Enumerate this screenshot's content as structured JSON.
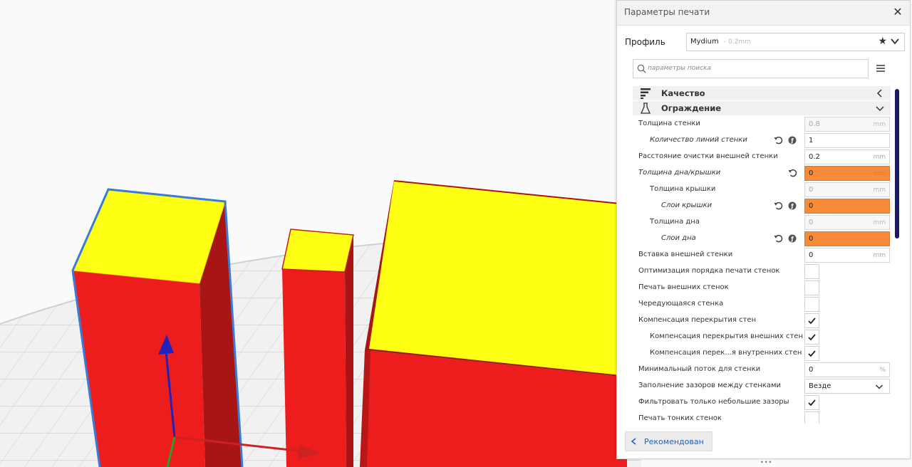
{
  "panel": {
    "title": "Параметры печати",
    "profile_label": "Профиль",
    "profile_name": "Mydium",
    "profile_layer": "- 0.2mm",
    "search_placeholder": "параметры поиска",
    "recommended_label": "Рекомендован"
  },
  "categories": [
    {
      "label": "Качество",
      "icon": "quality-icon",
      "state": "collapsed"
    },
    {
      "label": "Ограждение",
      "icon": "shell-icon",
      "state": "expanded"
    }
  ],
  "settings": [
    {
      "label": "Толщина стенки",
      "value": "0.8",
      "unit": "mm",
      "control": "field",
      "state": "disabled"
    },
    {
      "label": "Количество линий стенки",
      "value": "1",
      "unit": "",
      "control": "field",
      "state": "normal",
      "italic": true,
      "reset": true,
      "info": true
    },
    {
      "label": "Расстояние очистки внешней стенки",
      "value": "0.2",
      "unit": "mm",
      "control": "field",
      "state": "normal"
    },
    {
      "label": "Толщина дна/крышки",
      "value": "0",
      "unit": "mm",
      "control": "field",
      "state": "warning",
      "italic": true,
      "reset": true
    },
    {
      "label": "Толщина крышки",
      "value": "0",
      "unit": "mm",
      "control": "field",
      "state": "disabled"
    },
    {
      "label": "Слои крышки",
      "value": "0",
      "unit": "",
      "control": "field",
      "state": "warning",
      "italic": true,
      "reset": true,
      "info": true
    },
    {
      "label": "Толщина дна",
      "value": "0",
      "unit": "mm",
      "control": "field",
      "state": "disabled"
    },
    {
      "label": "Слои дна",
      "value": "0",
      "unit": "",
      "control": "field",
      "state": "warning",
      "italic": true,
      "reset": true,
      "info": true
    },
    {
      "label": "Вставка внешней стенки",
      "value": "0",
      "unit": "mm",
      "control": "field",
      "state": "normal"
    },
    {
      "label": "Оптимизация порядка печати стенок",
      "control": "checkbox",
      "checked": false
    },
    {
      "label": "Печать внешних стенок",
      "control": "checkbox",
      "checked": false
    },
    {
      "label": "Чередующаяся стенка",
      "control": "checkbox",
      "checked": false
    },
    {
      "label": "Компенсация перекрытия стен",
      "control": "checkbox",
      "checked": true
    },
    {
      "label": "Компенсация перекрытия внешних стен",
      "control": "checkbox",
      "checked": true
    },
    {
      "label": "Компенсация перек...я внутренних стен",
      "control": "checkbox",
      "checked": true
    },
    {
      "label": "Минимальный поток для стенки",
      "value": "0",
      "unit": "%",
      "control": "field",
      "state": "normal"
    },
    {
      "label": "Заполнение зазоров между стенками",
      "value": "Везде",
      "control": "combo"
    },
    {
      "label": "Фильтровать только небольшие зазоры",
      "control": "checkbox",
      "checked": true
    },
    {
      "label": "Печать тонких стенок",
      "control": "checkbox",
      "checked": false
    }
  ],
  "colors": {
    "model_side": "#ee1d1d",
    "model_top": "#ffff14",
    "warning_field": "#f88b3a",
    "axis_z": "#2222bb",
    "axis_x": "#cc2222",
    "scrollbar": "#1a1a5e",
    "link_text": "#1f5fb8"
  }
}
